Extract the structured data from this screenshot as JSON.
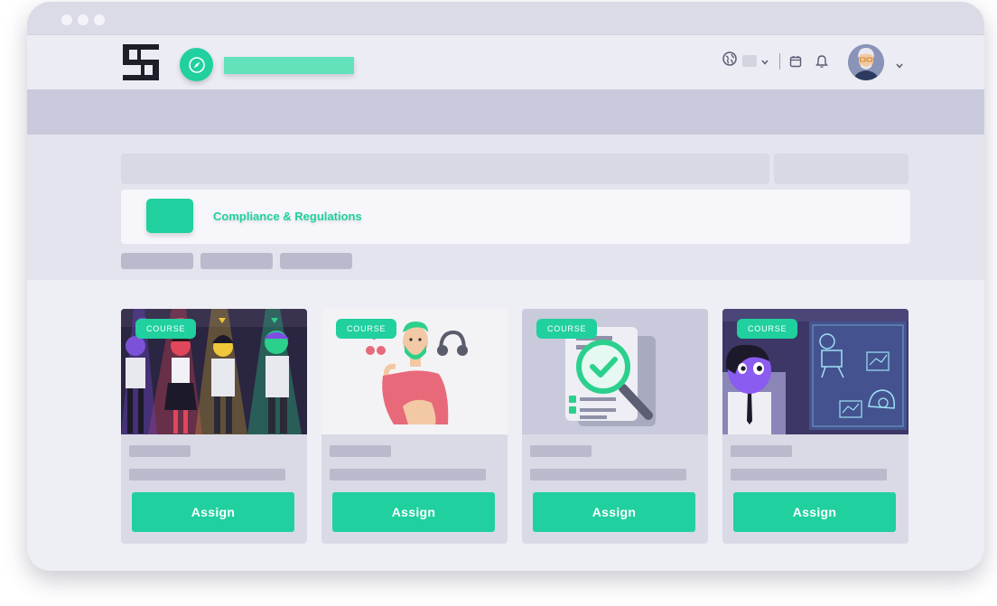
{
  "window": {
    "controls": [
      "close",
      "minimize",
      "maximize"
    ]
  },
  "navbar": {
    "logo_icon": "app-logo-icon",
    "compass_icon": "compass-icon",
    "language_icon": "globe-icon",
    "calendar_icon": "calendar-icon",
    "notification_icon": "bell-icon",
    "avatar_icon": "user-avatar",
    "chevron_icon": "chevron-down-icon"
  },
  "category": {
    "label": "Compliance & Regulations"
  },
  "colors": {
    "accent": "#20d09f",
    "background": "#e4e4ef",
    "placeholder": "#b9bacb"
  },
  "cards": [
    {
      "badge": "COURSE",
      "assign_label": "Assign",
      "image": "diverse-team-illustration"
    },
    {
      "badge": "COURSE",
      "assign_label": "Assign",
      "image": "thinking-man-headphones-illustration"
    },
    {
      "badge": "COURSE",
      "assign_label": "Assign",
      "image": "document-magnifier-check-illustration"
    },
    {
      "badge": "COURSE",
      "assign_label": "Assign",
      "image": "robot-blueprint-illustration"
    }
  ]
}
